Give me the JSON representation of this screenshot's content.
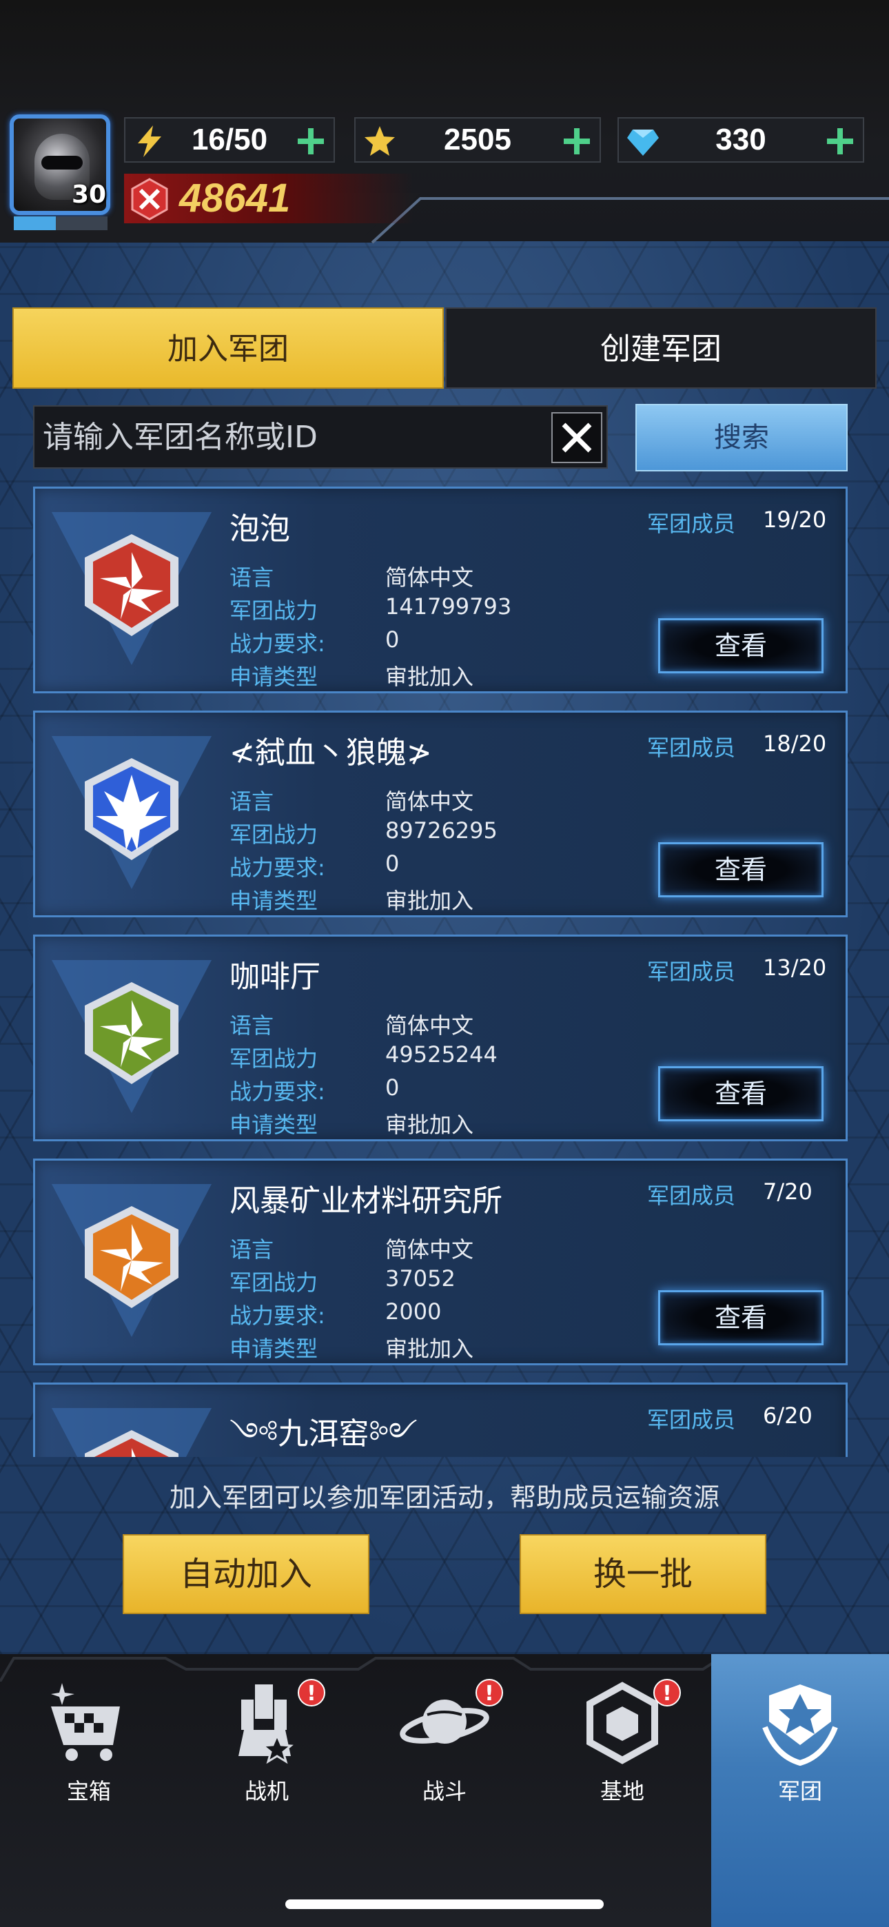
{
  "player": {
    "level": "30",
    "xp_fraction": 0.45,
    "energy": "16/50",
    "stars": "2505",
    "diamonds": "330",
    "power": "48641"
  },
  "tabs": {
    "join": "加入军团",
    "create": "创建军团"
  },
  "search": {
    "placeholder": "请输入军团名称或ID",
    "button": "搜索"
  },
  "labels": {
    "members": "军团成员",
    "language": "语言",
    "power": "军团战力",
    "requirement": "战力要求:",
    "apply_type": "申请类型",
    "view": "查看"
  },
  "legions": [
    {
      "name": "泡泡",
      "members": "19/20",
      "language": "简体中文",
      "power": "141799793",
      "requirement": "0",
      "apply_type": "审批加入",
      "badge_color": "#c8382c",
      "badge_icon": "pinwheel-icon"
    },
    {
      "name": "≮弑血丶狼魄≯",
      "members": "18/20",
      "language": "简体中文",
      "power": "89726295",
      "requirement": "0",
      "apply_type": "审批加入",
      "badge_color": "#2f5fd8",
      "badge_icon": "wing-crest-icon"
    },
    {
      "name": "咖啡厅",
      "members": "13/20",
      "language": "简体中文",
      "power": "49525244",
      "requirement": "0",
      "apply_type": "审批加入",
      "badge_color": "#6f9a2a",
      "badge_icon": "pinwheel-icon"
    },
    {
      "name": "风暴矿业材料研究所",
      "members": "7/20",
      "language": "简体中文",
      "power": "37052",
      "requirement": "2000",
      "apply_type": "审批加入",
      "badge_color": "#e07a20",
      "badge_icon": "pinwheel-icon"
    },
    {
      "name": "༺九洱窑༻",
      "members": "6/20",
      "language": "",
      "power": "",
      "requirement": "",
      "apply_type": "",
      "badge_color": "#c8382c",
      "badge_icon": "pinwheel-icon"
    }
  ],
  "hint": "加入军团可以参加军团活动，帮助成员运输资源",
  "actions": {
    "auto_join": "自动加入",
    "refresh": "换一批"
  },
  "nav": [
    {
      "label": "宝箱",
      "icon": "cart-icon",
      "alert": false,
      "active": false
    },
    {
      "label": "战机",
      "icon": "mech-icon",
      "alert": true,
      "active": false
    },
    {
      "label": "战斗",
      "icon": "planet-icon",
      "alert": true,
      "active": false
    },
    {
      "label": "基地",
      "icon": "base-icon",
      "alert": true,
      "active": false
    },
    {
      "label": "军团",
      "icon": "legion-icon",
      "alert": false,
      "active": true
    }
  ],
  "colors": {
    "accent_gold": "#f1c642",
    "accent_blue": "#58b8f0",
    "alert_red": "#e23535"
  }
}
